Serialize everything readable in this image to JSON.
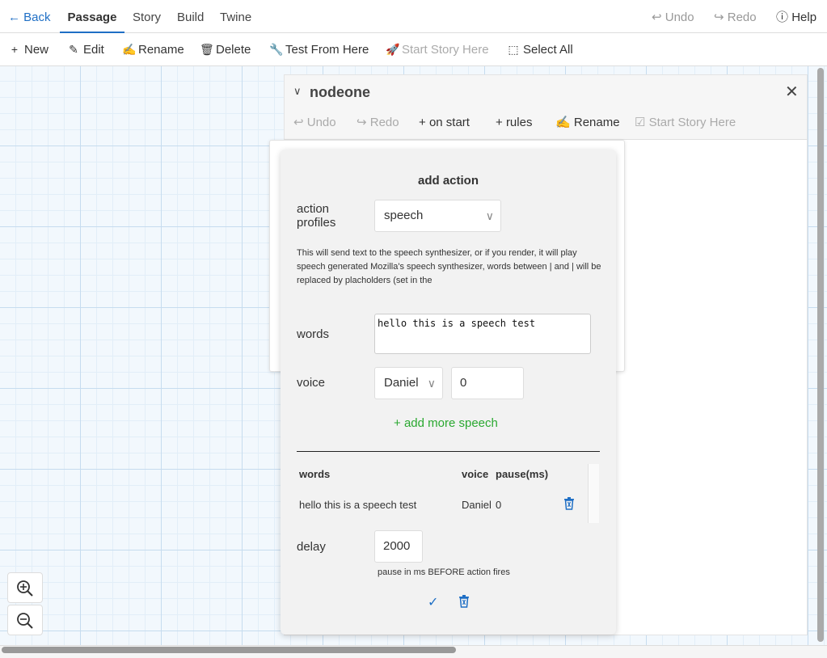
{
  "topbar": {
    "back": "Back",
    "tabs": [
      "Passage",
      "Story",
      "Build",
      "Twine"
    ],
    "undo": "Undo",
    "redo": "Redo",
    "help": "Help"
  },
  "toolbar": {
    "new": "New",
    "edit": "Edit",
    "rename": "Rename",
    "delete": "Delete",
    "test_from_here": "Test From Here",
    "start_story_here": "Start Story Here",
    "select_all": "Select All"
  },
  "passage_dialog": {
    "title": "nodeone",
    "undo": "Undo",
    "redo": "Redo",
    "on_start": "on start",
    "rules": "rules",
    "rename": "Rename",
    "start_story_here": "Start Story Here"
  },
  "action_panel": {
    "title": "add action",
    "profiles_label": "action profiles",
    "profile_value": "speech",
    "description": "This will send text to the speech synthesizer, or if you render, it will play speech generated Mozilla's speech synthesizer, words between | and | will be replaced by placholders (set in the",
    "words_label": "words",
    "words_value": "hello this is a speech test",
    "voice_label": "voice",
    "voice_value": "Daniel",
    "pause_value": "0",
    "add_more": "add more speech",
    "table": {
      "headers": [
        "words",
        "voice",
        "pause(ms)"
      ],
      "rows": [
        {
          "words": "hello this is a speech test",
          "voice": "Daniel",
          "pause": "0"
        }
      ]
    },
    "delay_label": "delay",
    "delay_value": "2000",
    "delay_hint": "pause in ms BEFORE action fires"
  },
  "colors": {
    "accent": "#1f6fc5",
    "add_green": "#2aa830",
    "canvas_bg": "#f2f8fd"
  }
}
